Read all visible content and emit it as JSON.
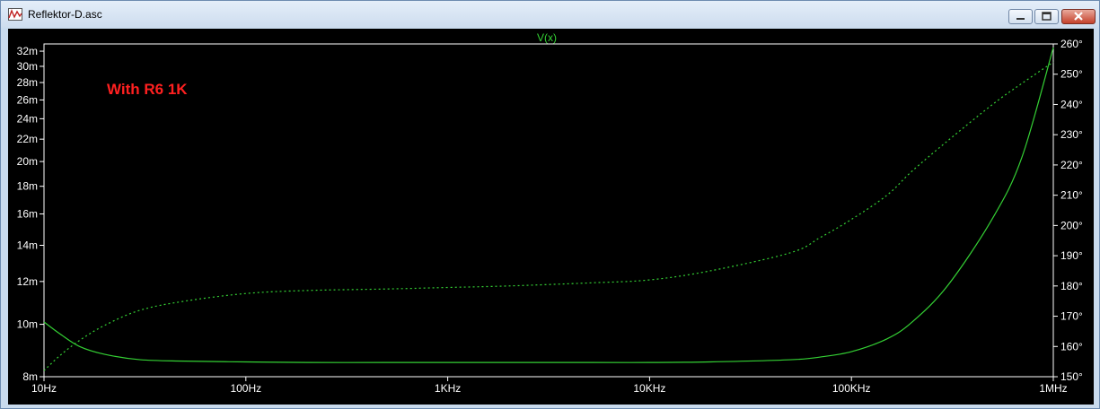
{
  "window": {
    "title": "Reflektor-D.asc"
  },
  "icons": {
    "app": "waveform-icon",
    "minimize": "minimize-icon",
    "maximize": "maximize-icon",
    "close": "close-icon"
  },
  "colors": {
    "trace": "#34d034",
    "grid_text": "#ffffff",
    "annotation": "#ff2020",
    "background": "#000000"
  },
  "chart_data": {
    "type": "line",
    "title": "V(x)",
    "annotation": "With R6 1K",
    "x_scale": "log",
    "xlim": [
      10,
      1000000
    ],
    "x_ticks": [
      {
        "v": 10,
        "label": "10Hz"
      },
      {
        "v": 100,
        "label": "100Hz"
      },
      {
        "v": 1000,
        "label": "1KHz"
      },
      {
        "v": 10000,
        "label": "10KHz"
      },
      {
        "v": 100000,
        "label": "100KHz"
      },
      {
        "v": 1000000,
        "label": "1MHz"
      }
    ],
    "y_scale": "log",
    "ylim": [
      0.008,
      0.033
    ],
    "y_ticks": [
      {
        "v": 0.008,
        "label": "8m"
      },
      {
        "v": 0.01,
        "label": "10m"
      },
      {
        "v": 0.012,
        "label": "12m"
      },
      {
        "v": 0.014,
        "label": "14m"
      },
      {
        "v": 0.016,
        "label": "16m"
      },
      {
        "v": 0.018,
        "label": "18m"
      },
      {
        "v": 0.02,
        "label": "20m"
      },
      {
        "v": 0.022,
        "label": "22m"
      },
      {
        "v": 0.024,
        "label": "24m"
      },
      {
        "v": 0.026,
        "label": "26m"
      },
      {
        "v": 0.028,
        "label": "28m"
      },
      {
        "v": 0.03,
        "label": "30m"
      },
      {
        "v": 0.032,
        "label": "32m"
      }
    ],
    "y2lim": [
      150,
      260
    ],
    "y2_ticks": [
      {
        "v": 150,
        "label": "150°"
      },
      {
        "v": 160,
        "label": "160°"
      },
      {
        "v": 170,
        "label": "170°"
      },
      {
        "v": 180,
        "label": "180°"
      },
      {
        "v": 190,
        "label": "190°"
      },
      {
        "v": 200,
        "label": "200°"
      },
      {
        "v": 210,
        "label": "210°"
      },
      {
        "v": 220,
        "label": "220°"
      },
      {
        "v": 230,
        "label": "230°"
      },
      {
        "v": 240,
        "label": "240°"
      },
      {
        "v": 250,
        "label": "250°"
      },
      {
        "v": 260,
        "label": "260°"
      }
    ],
    "grid": false,
    "series": [
      {
        "axis": "left",
        "style": "solid",
        "x": [
          10,
          12,
          15,
          20,
          30,
          50,
          100,
          200,
          500,
          1000,
          2000,
          5000,
          10000,
          20000,
          50000,
          70000,
          100000,
          150000,
          200000,
          300000,
          500000,
          700000,
          1000000
        ],
        "y": [
          0.0101,
          0.0096,
          0.0091,
          0.0088,
          0.0086,
          0.00855,
          0.00852,
          0.0085,
          0.0085,
          0.0085,
          0.0085,
          0.0085,
          0.0085,
          0.00852,
          0.0086,
          0.0087,
          0.0089,
          0.0094,
          0.0101,
          0.0118,
          0.0157,
          0.0204,
          0.0325
        ]
      },
      {
        "axis": "right",
        "style": "dotted",
        "x": [
          10,
          12,
          15,
          20,
          30,
          50,
          100,
          200,
          500,
          1000,
          2000,
          5000,
          10000,
          20000,
          50000,
          70000,
          100000,
          150000,
          200000,
          300000,
          500000,
          700000,
          1000000
        ],
        "y": [
          152,
          157,
          162,
          167,
          172,
          175,
          177.5,
          178.5,
          179,
          179.5,
          180,
          181,
          182,
          185,
          191,
          196,
          202,
          210,
          218,
          228,
          240,
          247,
          254
        ]
      }
    ]
  }
}
